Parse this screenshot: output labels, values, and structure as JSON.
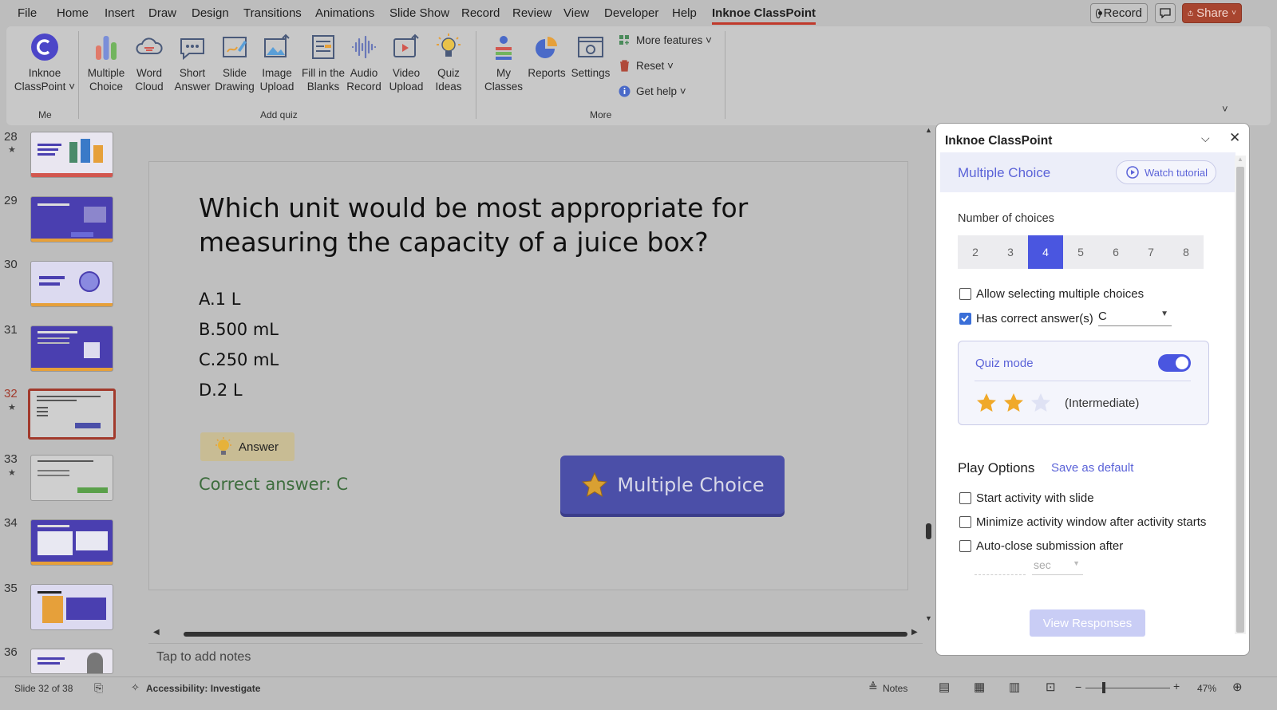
{
  "menu": {
    "items": [
      "File",
      "Home",
      "Insert",
      "Draw",
      "Design",
      "Transitions",
      "Animations",
      "Slide Show",
      "Record",
      "Review",
      "View",
      "Developer",
      "Help",
      "Inknoe ClassPoint"
    ],
    "active": "Inknoe ClassPoint",
    "record_label": "Record",
    "share_label": "Share"
  },
  "ribbon": {
    "classpoint_line1": "Inknoe",
    "classpoint_line2": "ClassPoint ˅",
    "group_me": "Me",
    "quiz_buttons": [
      {
        "l1": "Multiple",
        "l2": "Choice",
        "icon": "bar-chart-icon"
      },
      {
        "l1": "Word",
        "l2": "Cloud",
        "icon": "word-cloud-icon"
      },
      {
        "l1": "Short",
        "l2": "Answer",
        "icon": "chat-bubble-icon"
      },
      {
        "l1": "Slide",
        "l2": "Drawing",
        "icon": "drawing-icon"
      },
      {
        "l1": "Image",
        "l2": "Upload",
        "icon": "image-upload-icon"
      },
      {
        "l1": "Fill in the",
        "l2": "Blanks",
        "icon": "fill-blanks-icon"
      },
      {
        "l1": "Audio",
        "l2": "Record",
        "icon": "audio-wave-icon"
      },
      {
        "l1": "Video",
        "l2": "Upload",
        "icon": "video-upload-icon"
      },
      {
        "l1": "Quiz",
        "l2": "Ideas",
        "icon": "lightbulb-icon"
      }
    ],
    "group_addquiz": "Add quiz",
    "more_buttons": [
      {
        "l1": "My",
        "l2": "Classes",
        "icon": "classes-icon"
      },
      {
        "l1": "Reports",
        "l2": "",
        "icon": "pie-chart-icon"
      },
      {
        "l1": "Settings",
        "l2": "",
        "icon": "settings-icon"
      }
    ],
    "more_features": "More features ˅",
    "reset": "Reset ˅",
    "get_help": "Get help ˅",
    "group_more": "More"
  },
  "thumbnails": [
    {
      "num": "28",
      "star": true
    },
    {
      "num": "29",
      "star": false
    },
    {
      "num": "30",
      "star": false
    },
    {
      "num": "31",
      "star": false
    },
    {
      "num": "32",
      "star": true,
      "selected": true
    },
    {
      "num": "33",
      "star": true
    },
    {
      "num": "34",
      "star": false
    },
    {
      "num": "35",
      "star": false
    },
    {
      "num": "36",
      "star": false
    }
  ],
  "slide": {
    "question": "Which unit would be most appropriate for measuring the capacity of a juice box?",
    "options": [
      "A.1 L",
      "B.500 mL",
      "C.250 mL",
      "D.2 L"
    ],
    "answer_btn": "Answer",
    "correct": "Correct answer: C",
    "mc_button": "Multiple Choice"
  },
  "notes_placeholder": "Tap to add notes",
  "status": {
    "slide_info": "Slide 32 of 38",
    "accessibility": "Accessibility: Investigate",
    "notes": "Notes",
    "zoom": "47%"
  },
  "panel": {
    "title": "Inknoe ClassPoint",
    "subtitle": "Multiple Choice",
    "watch_tutorial": "Watch tutorial",
    "num_choices_label": "Number of choices",
    "choices": [
      "2",
      "3",
      "4",
      "5",
      "6",
      "7",
      "8"
    ],
    "selected_choice": "4",
    "allow_multiple": "Allow selecting multiple choices",
    "has_correct": "Has correct answer(s)",
    "correct_value": "C",
    "quiz_mode": "Quiz mode",
    "quiz_mode_on": true,
    "difficulty_stars": 2,
    "difficulty_max": 3,
    "difficulty_label": "(Intermediate)",
    "play_options": "Play Options",
    "save_default": "Save as default",
    "start_with_slide": "Start activity with slide",
    "minimize_window": "Minimize activity window after activity starts",
    "auto_close": "Auto-close submission after",
    "sec_placeholder": "sec",
    "view_responses": "View Responses"
  },
  "colors": {
    "accent": "#4a56e0",
    "panel_link": "#5b63d8",
    "star": "#f0a92a",
    "mc_button": "#4b4fa8",
    "correct_text": "#3d6d3d"
  }
}
